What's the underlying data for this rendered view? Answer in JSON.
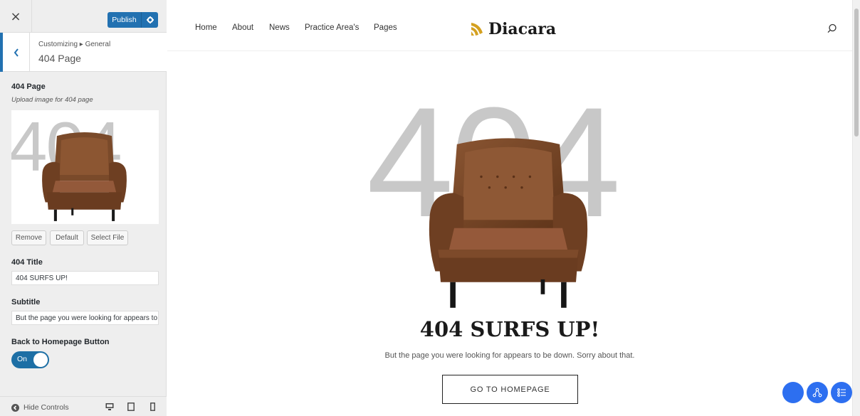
{
  "customizer": {
    "close_label": "×",
    "publish_label": "Publish",
    "breadcrumb": "Customizing ▸ General",
    "section_title": "404 Page",
    "image_field": {
      "label": "404 Page",
      "description": "Upload image for 404 page",
      "preview_text": "404"
    },
    "image_buttons": [
      "Remove",
      "Default",
      "Select File"
    ],
    "title_field": {
      "label": "404 Title",
      "value": "404 SURFS UP!"
    },
    "subtitle_field": {
      "label": "Subtitle",
      "value": "But the page you were looking for appears to be down. Sorry about that."
    },
    "home_button_field": {
      "label": "Back to Homepage Button",
      "toggle_text": "On",
      "enabled": true
    },
    "footer": {
      "hide_controls_label": "Hide Controls"
    }
  },
  "site": {
    "nav": [
      "Home",
      "About",
      "News",
      "Practice Area's",
      "Pages"
    ],
    "logo_text": "Diacara",
    "big_number": "404",
    "title": "404 SURFS UP!",
    "subtitle": "But the page you were looking for appears to be down. Sorry about that.",
    "home_button": "GO TO HOMEPAGE"
  },
  "colors": {
    "accent": "#2271b1",
    "toggle": "#1d6fa5",
    "fab": "#2d6ff0",
    "big_number": "#c8c8c8",
    "logo_gold": "#d4a020"
  }
}
